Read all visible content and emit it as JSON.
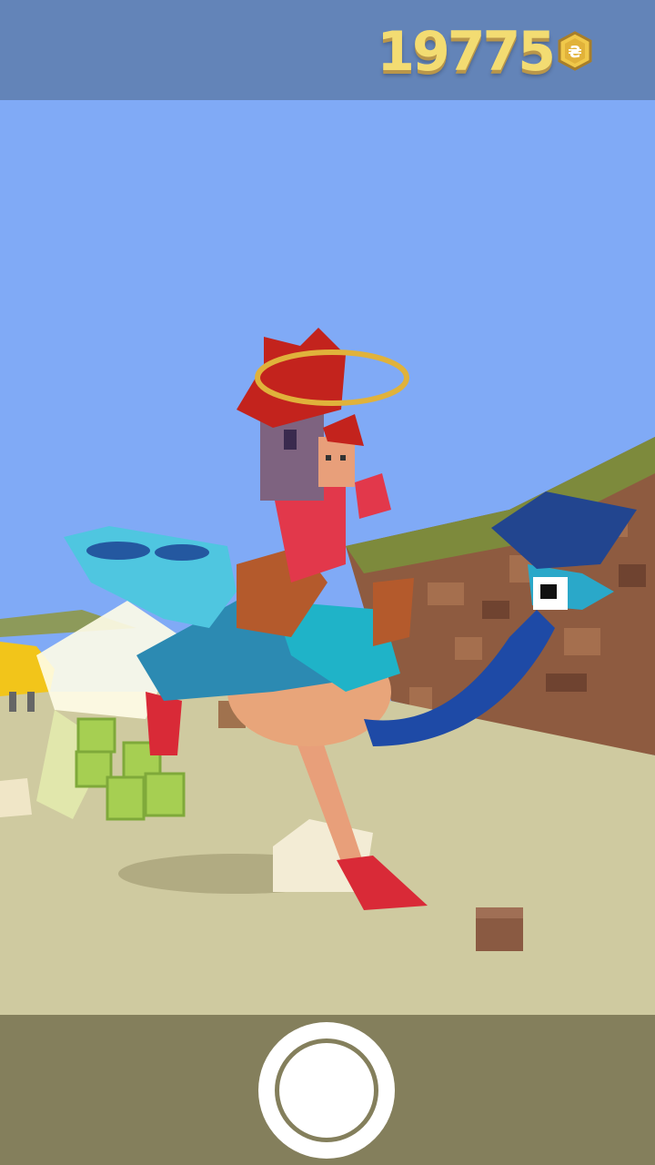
{
  "hud": {
    "coin_count": "19775",
    "coin_icon": "coin-icon"
  },
  "controls": {
    "shutter": "camera-shutter-button"
  },
  "colors": {
    "top_bar": "#6384b8",
    "sky": "#7fa9f5",
    "ground": "#cfcaa0",
    "bottom_bar": "#847f5c",
    "coin_text": "#f3dc72"
  }
}
